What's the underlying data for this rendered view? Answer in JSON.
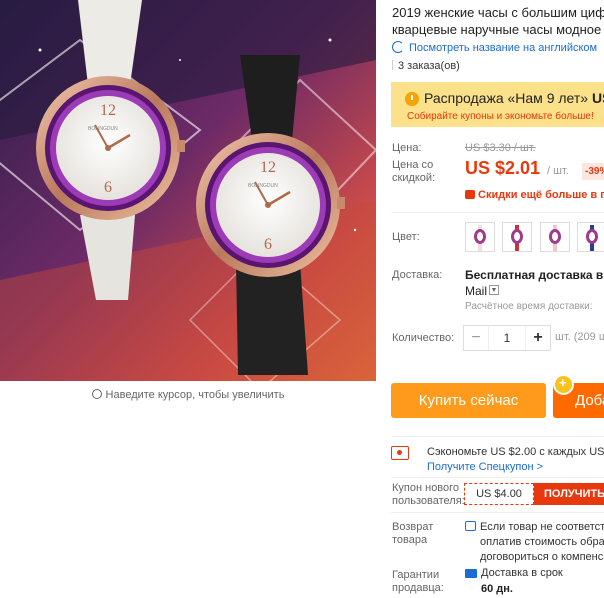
{
  "product": {
    "title_line1": "2019 женские часы с большим циф",
    "title_line2": "кварцевые наручные часы модное",
    "translate_link": "Посмотреть название на английском",
    "orders": "3 заказа(ов)",
    "zoom_hint": "Наведите курсор, чтобы увеличить",
    "watch_brand": "BOLINGDUN",
    "dial_numbers": [
      "12",
      "6"
    ]
  },
  "sale": {
    "title": "Распродажа «Нам 9 лет»",
    "title_tail": "US",
    "subtitle": "Собирайте купоны и экономьте больше!"
  },
  "pricing": {
    "price_label": "Цена:",
    "old_price": "US $3.30 / шт.",
    "discount_label": "Цена со скидкой:",
    "price": "US $2.01",
    "unit": "/ шт.",
    "discount": "-39%",
    "more_discounts": "Скидки ещё больше в пра"
  },
  "options": {
    "color_label": "Цвет:",
    "swatches": [
      {
        "name": "white-pink",
        "strap": "#f3dede"
      },
      {
        "name": "red",
        "strap": "#c8323c"
      },
      {
        "name": "pink",
        "strap": "#f0c5c8"
      },
      {
        "name": "blue",
        "strap": "#2b3f8f"
      }
    ]
  },
  "shipping": {
    "label": "Доставка:",
    "title": "Бесплатная доставка в Rus",
    "carrier": "Mail",
    "estimate": "Расчётное время доставки:"
  },
  "quantity": {
    "label": "Количество:",
    "minus": "−",
    "value": "1",
    "plus": "+",
    "stock": "шт. (209 ш"
  },
  "actions": {
    "buy": "Купить сейчас",
    "add_cart": "Доба"
  },
  "coupon": {
    "save_line": "Сэкономьте US $2.00 с каждых US $",
    "get_link": "Получите Спецкупон >",
    "new_user_label": "Купон нового пользователя:",
    "new_user_value": "US $4.00",
    "get_button": "ПОЛУЧИТЬ"
  },
  "guarantees": {
    "return_label": "Возврат товара",
    "return_text": [
      "Если товар не соответств",
      "оплатив стоимость обрат",
      "договориться о компенса"
    ],
    "seller_label": "Гарантии продавца:",
    "delivery_line1": "Доставка в срок",
    "delivery_line2": "60 дн."
  },
  "colors": {
    "accent": "#e8390e",
    "buy_button": "#ff9a1b",
    "cart_button": "#ff6a00",
    "link": "#1a6dd2",
    "sale_bg": "#fbe18a"
  }
}
